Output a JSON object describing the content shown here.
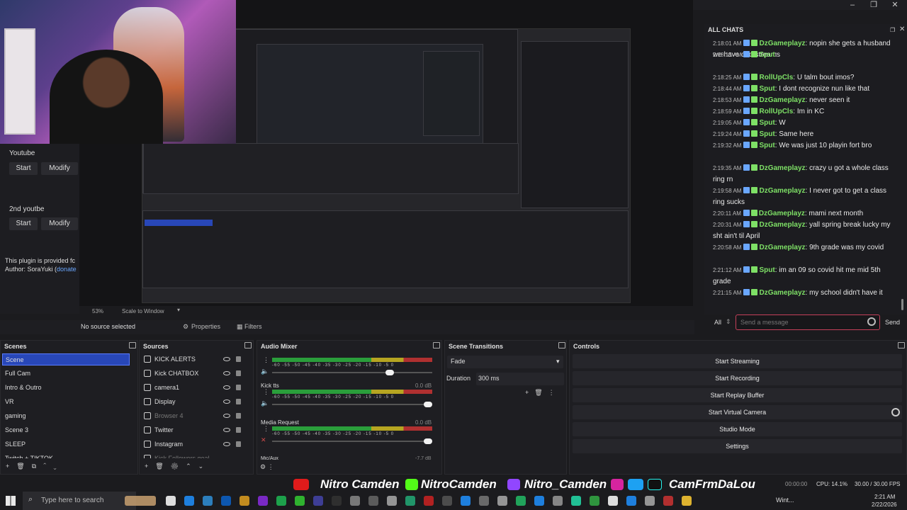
{
  "window": {
    "minimize": "–",
    "maximize": "❐",
    "close": "✕"
  },
  "left_panel": {
    "youtube_label": "Youtube",
    "youtube_start": "Start",
    "youtube_modify": "Modify",
    "youtube2_label": "2nd youtbe",
    "youtube2_start": "Start",
    "youtube2_modify": "Modify",
    "plugin_note": "This plugin is provided fc",
    "author_prefix": "Author: SoraYuki (",
    "author_link": "donate"
  },
  "preview_footer": {
    "zoom": "53%",
    "scale": "Scale to Window"
  },
  "chat": {
    "title": "ALL CHATS",
    "messages": [
      {
        "time": "2:18:01 AM",
        "user": "DzGameplayz",
        "text": "nopin she gets a husband we have dad streams"
      },
      {
        "time": "2:18:15 AM",
        "user": "Sput",
        "text": ""
      },
      {
        "time": "2:18:25 AM",
        "user": "RollUpCls",
        "text": "U talm bout imos?"
      },
      {
        "time": "2:18:44 AM",
        "user": "Sput",
        "text": "I dont recognize nun like that"
      },
      {
        "time": "2:18:53 AM",
        "user": "DzGameplayz",
        "text": "never seen it"
      },
      {
        "time": "2:18:59 AM",
        "user": "RollUpCls",
        "text": "Im in KC"
      },
      {
        "time": "2:19:05 AM",
        "user": "Sput",
        "text": "W"
      },
      {
        "time": "2:19:24 AM",
        "user": "Sput",
        "text": "Same here"
      },
      {
        "time": "2:19:32 AM",
        "user": "Sput",
        "text": "We was just 10 playin fort bro"
      },
      {
        "time": "2:19:35 AM",
        "user": "DzGameplayz",
        "text": "crazy u got a whole class ring rn"
      },
      {
        "time": "2:19:58 AM",
        "user": "DzGameplayz",
        "text": "I never got to get a class ring sucks"
      },
      {
        "time": "2:20:11 AM",
        "user": "DzGameplayz",
        "text": "mami next month"
      },
      {
        "time": "2:20:31 AM",
        "user": "DzGameplayz",
        "text": "yall spring break lucky my sht ain't til April"
      },
      {
        "time": "2:20:58 AM",
        "user": "DzGameplayz",
        "text": "9th grade was my covid"
      },
      {
        "time": "2:21:12 AM",
        "user": "Sput",
        "text": "im an 09 so covid hit me mid 5th grade"
      },
      {
        "time": "2:21:15 AM",
        "user": "DzGameplayz",
        "text": "my school didn't have it"
      }
    ],
    "channel": "All",
    "input_placeholder": "Send a message",
    "send": "Send"
  },
  "source_bar": {
    "status": "No source selected",
    "properties": "Properties",
    "filters": "Filters"
  },
  "scenes": {
    "title": "Scenes",
    "items": [
      "Scene",
      "Full Cam",
      "Intro & Outro",
      "VR",
      "gaming",
      "Scene 3",
      "SLEEP",
      "Twitch + TIKTOK"
    ]
  },
  "sources": {
    "title": "Sources",
    "items": [
      "KICK ALERTS",
      "Kick CHATBOX",
      "camera1",
      "Display",
      "Browser 4",
      "Twitter",
      "Instagram",
      "Kick Followers goal"
    ]
  },
  "audio": {
    "title": "Audio Mixer",
    "scale": "-60 -55 -50 -45 -40 -35 -30 -25 -20 -15 -10 -5 0",
    "channels": [
      {
        "name": "",
        "db": ""
      },
      {
        "name": "Kick tts",
        "db": "0.0 dB"
      },
      {
        "name": "Media Request",
        "db": "0.0 dB"
      },
      {
        "name": "Mic/Aux",
        "db": "-7.7 dB"
      }
    ]
  },
  "transitions": {
    "title": "Scene Transitions",
    "type": "Fade",
    "duration_label": "Duration",
    "duration": "300 ms"
  },
  "controls": {
    "title": "Controls",
    "buttons": [
      "Start Streaming",
      "Start Recording",
      "Start Replay Buffer",
      "Start Virtual Camera",
      "Studio Mode",
      "Settings"
    ]
  },
  "socials": {
    "youtube": "Nitro Camden",
    "kick": "NitroCamden",
    "twitch": "Nitro_Camden",
    "tiktok": "CamFrmDaLou"
  },
  "status_bar": {
    "time_code": "00:00:00",
    "cpu": "CPU: 14.1%",
    "fps": "30.00 / 30.00 FPS"
  },
  "taskbar": {
    "search": "Type here to search",
    "weather": "Wint...",
    "clock_time": "2:21 AM",
    "clock_date": "2/22/2026"
  },
  "colors": {
    "accent": "#2847b8",
    "chat_user": "#7ee066",
    "input_border": "#c4405a"
  }
}
